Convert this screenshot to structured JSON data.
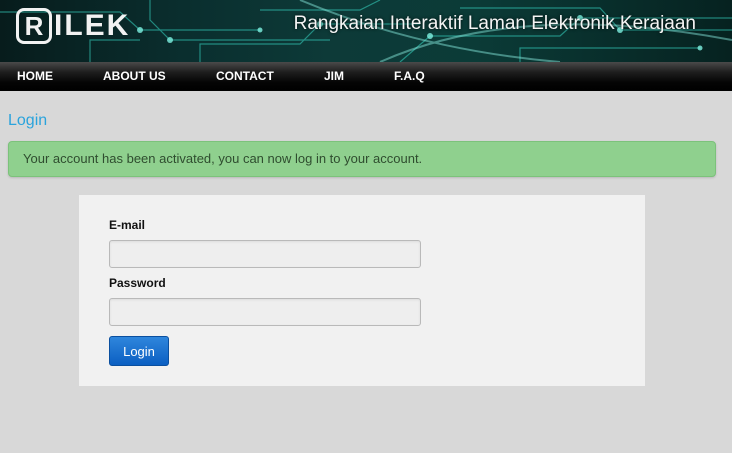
{
  "header": {
    "logo_initial": "R",
    "logo_rest": "ILEK",
    "tagline": "Rangkaian Interaktif Laman Elektronik Kerajaan"
  },
  "nav": {
    "items": [
      {
        "label": "HOME"
      },
      {
        "label": "ABOUT US"
      },
      {
        "label": "CONTACT"
      },
      {
        "label": "JIM"
      },
      {
        "label": "F.A.Q"
      }
    ]
  },
  "page": {
    "title": "Login"
  },
  "alert": {
    "message": "Your account has been activated, you can now log in to your account."
  },
  "form": {
    "email_label": "E-mail",
    "email_value": "",
    "password_label": "Password",
    "password_value": "",
    "submit_label": "Login"
  },
  "colors": {
    "title": "#2aa3dc",
    "alert_bg": "#8fd08e",
    "button": "#0b5fc2",
    "nav_bg": "#000000"
  }
}
